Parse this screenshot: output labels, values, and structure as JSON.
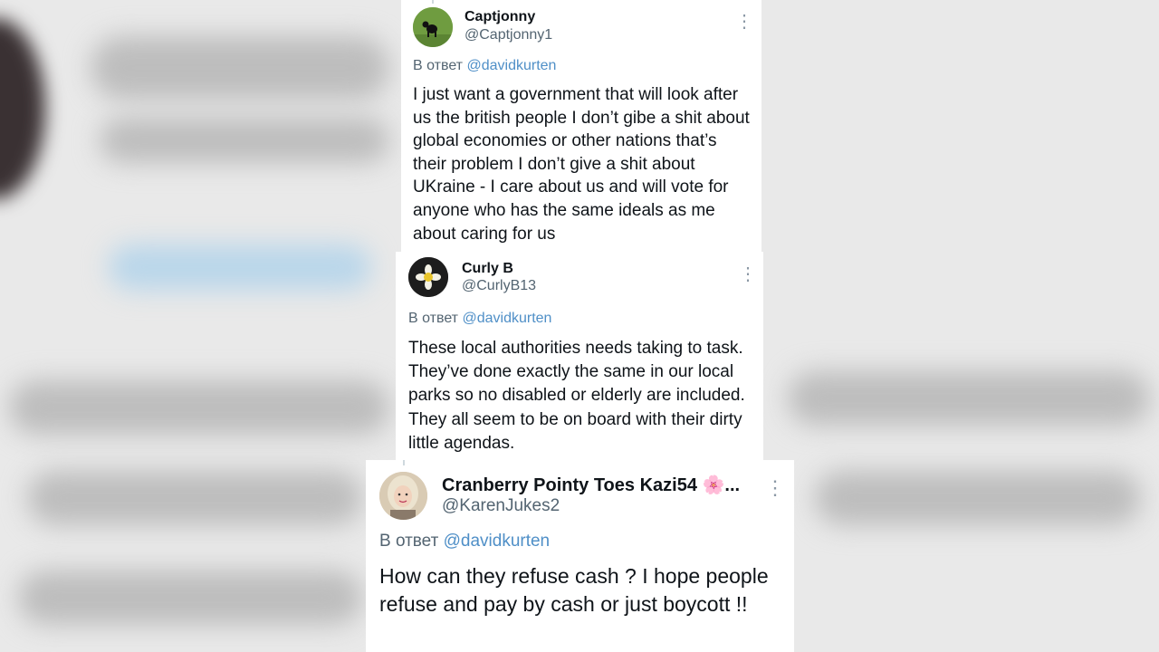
{
  "reply_prefix": "В ответ",
  "more_glyph": "⋮",
  "tweets": [
    {
      "name": "Captjonny",
      "handle": "@Captjonny1",
      "reply_to": "@davidkurten",
      "avatar_icon": "dog-avatar-icon",
      "text": "I just want a government that will look after us the british people I don’t gibe a shit about global economies or other nations that’s their problem I don’t give a shit about UKraine - I care about us and will vote for anyone who has the same ideals as me about caring for us"
    },
    {
      "name": "Curly B",
      "handle": "@CurlyB13",
      "reply_to": "@davidkurten",
      "avatar_icon": "flower-avatar-icon",
      "text": "These local authorities needs taking to task. They’ve done exactly the same in our local parks so no disabled or elderly are included. They all seem to be on board with their dirty little agendas."
    },
    {
      "name": "Cranberry Pointy Toes Kazi54 🌸...",
      "handle": "@KarenJukes2",
      "reply_to": "@davidkurten",
      "avatar_icon": "woman-avatar-icon",
      "text": "How can they refuse cash ? I hope people refuse and pay by cash or just boycott !!"
    }
  ],
  "colors": {
    "mention": "#4f8fc7",
    "secondary_text": "#536471",
    "card_bg": "#ffffff"
  }
}
